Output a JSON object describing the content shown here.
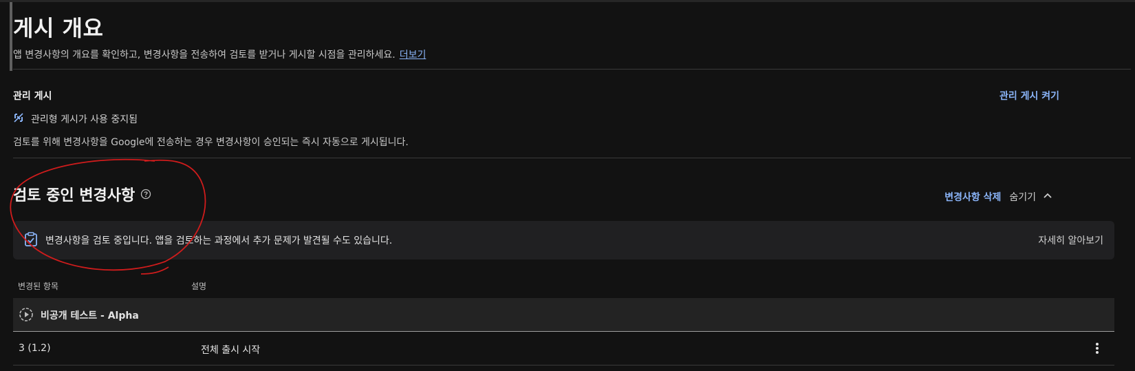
{
  "header": {
    "title": "게시 개요",
    "description": "앱 변경사항의 개요를 확인하고, 변경사항을 전송하여 검토를 받거나 게시할 시점을 관리하세요.",
    "more_link": "더보기"
  },
  "managed_publishing": {
    "label": "관리 게시",
    "enable_link": "관리 게시 켜기",
    "status": "관리형 게시가 사용 중지됨",
    "note": "검토를 위해 변경사항을 Google에 전송하는 경우 변경사항이 승인되는 즉시 자동으로 게시됩니다."
  },
  "review": {
    "title": "검토 중인 변경사항",
    "delete_link": "변경사항 삭제",
    "hide_label": "숨기기",
    "banner_text": "변경사항을 검토 중입니다. 앱을 검토하는 과정에서 추가 문제가 발견될 수도 있습니다.",
    "banner_link": "자세히 알아보기",
    "columns": [
      "변경된 항목",
      "설명"
    ],
    "group": {
      "label": "비공개 테스트 - Alpha"
    },
    "rows": [
      {
        "item": "3 (1.2)",
        "description": "전체 출시 시작"
      }
    ]
  },
  "colors": {
    "accent": "#8ab4f8",
    "background": "#121212",
    "annotation": "#d01c1c"
  },
  "icons": [
    "managed-publishing-off-icon",
    "help-icon",
    "chevron-up-icon",
    "clipboard-check-icon",
    "track-play-icon",
    "more-vert-icon"
  ]
}
